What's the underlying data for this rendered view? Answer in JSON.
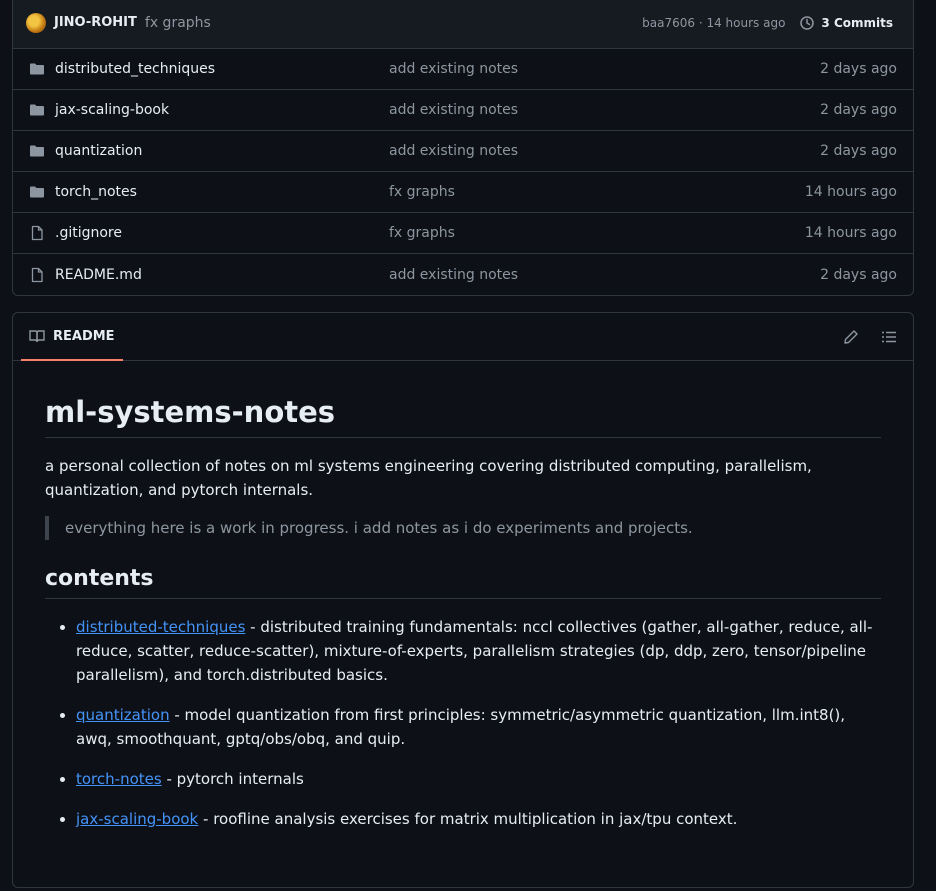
{
  "commit": {
    "author": "JINO-ROHIT",
    "message": "fx graphs",
    "hash_time": "baa7606 · 14 hours ago",
    "commits_label": "3 Commits"
  },
  "files": [
    {
      "type": "folder",
      "icon": "folder-icon",
      "name": "distributed_techniques",
      "message": "add existing notes",
      "time": "2 days ago"
    },
    {
      "type": "folder",
      "icon": "folder-icon",
      "name": "jax-scaling-book",
      "message": "add existing notes",
      "time": "2 days ago"
    },
    {
      "type": "folder",
      "icon": "folder-icon",
      "name": "quantization",
      "message": "add existing notes",
      "time": "2 days ago"
    },
    {
      "type": "folder",
      "icon": "folder-icon",
      "name": "torch_notes",
      "message": "fx graphs",
      "time": "14 hours ago"
    },
    {
      "type": "file",
      "icon": "file-icon",
      "name": ".gitignore",
      "message": "fx graphs",
      "time": "14 hours ago"
    },
    {
      "type": "file",
      "icon": "file-icon",
      "name": "README.md",
      "message": "add existing notes",
      "time": "2 days ago"
    }
  ],
  "readme": {
    "tab_label": "README",
    "title": "ml-systems-notes",
    "intro": "a personal collection of notes on ml systems engineering covering distributed computing, parallelism, quantization, and pytorch internals.",
    "quote": "everything here is a work in progress. i add notes as i do experiments and projects.",
    "contents_heading": "contents",
    "items": [
      {
        "link": "distributed-techniques",
        "text": " - distributed training fundamentals: nccl collectives (gather, all-gather, reduce, all-reduce, scatter, reduce-scatter), mixture-of-experts, parallelism strategies (dp, ddp, zero, tensor/pipeline parallelism), and torch.distributed basics."
      },
      {
        "link": "quantization",
        "text": " - model quantization from first principles: symmetric/asymmetric quantization, llm.int8(), awq, smoothquant, gptq/obs/obq, and quip."
      },
      {
        "link": "torch-notes",
        "text": " - pytorch internals"
      },
      {
        "link": "jax-scaling-book",
        "text": " - roofline analysis exercises for matrix multiplication in jax/tpu context."
      }
    ]
  },
  "colors": {
    "background": "#0d1117",
    "border": "#30363d",
    "muted_text": "#8d96a0",
    "link": "#4493f8",
    "tab_accent": "#f78166"
  }
}
